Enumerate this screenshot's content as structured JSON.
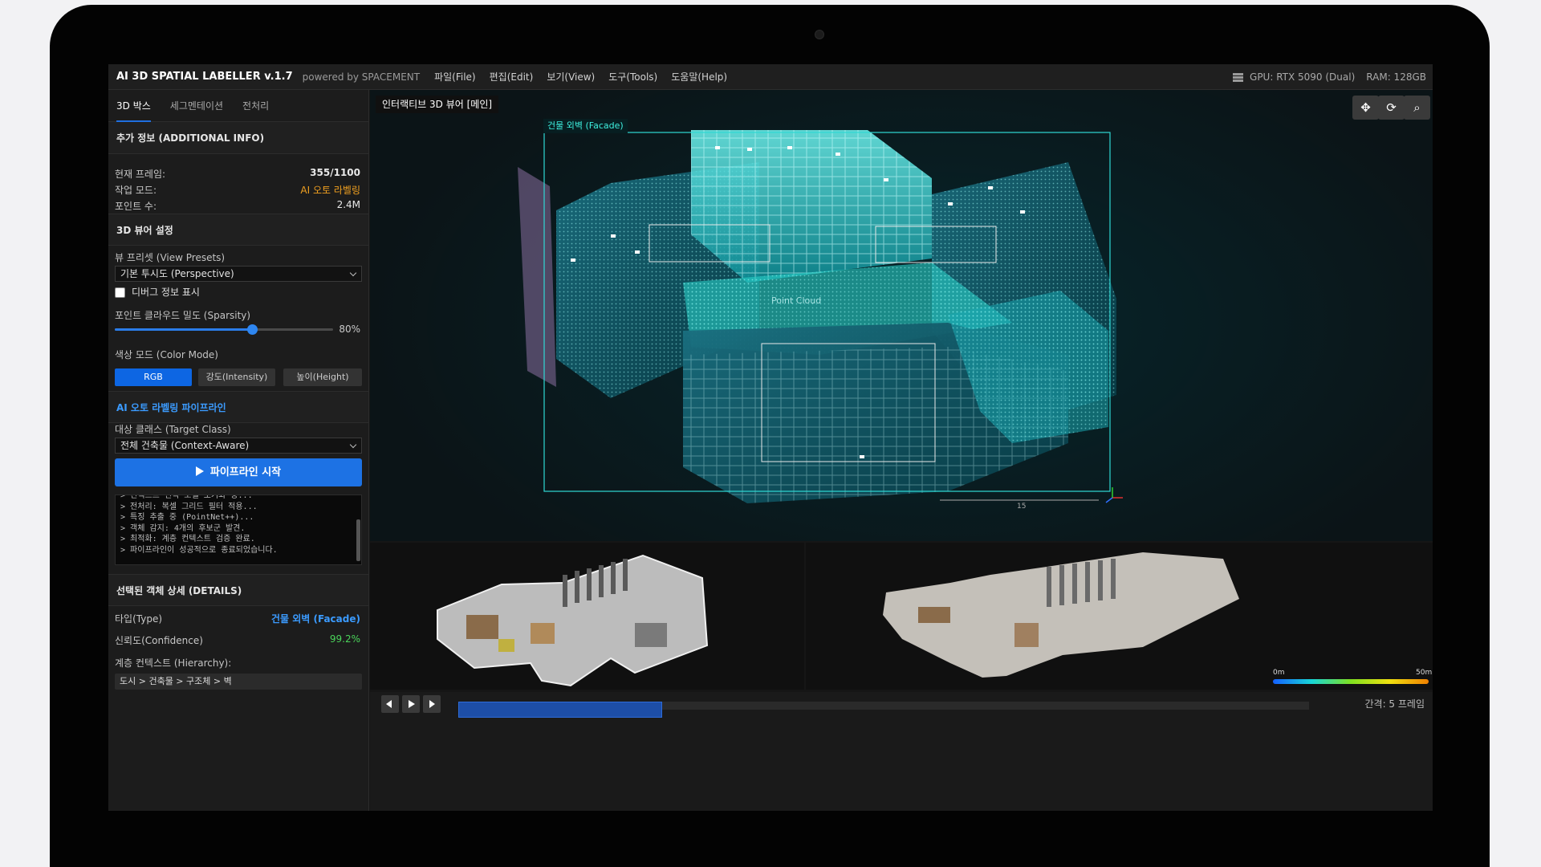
{
  "app": {
    "title": "AI 3D SPATIAL LABELLER v.1.7",
    "powered_by": "powered by SPACEMENT",
    "menu": [
      "파일(File)",
      "편집(Edit)",
      "보기(View)",
      "도구(Tools)",
      "도움말(Help)"
    ],
    "gpu": "GPU: RTX 5090 (Dual)",
    "ram": "RAM: 128GB"
  },
  "left": {
    "tabs": [
      "3D 박스",
      "세그멘테이션",
      "전처리"
    ],
    "additional_info": {
      "header": "추가 정보 (ADDITIONAL INFO)",
      "frame_label": "현재 프레임:",
      "frame_value": "355/1100",
      "mode_label": "작업 모드:",
      "mode_value": "AI 오토 라벨링",
      "points_label": "포인트 수:",
      "points_value": "2.4M"
    },
    "viewer_settings": {
      "header": "3D 뷰어 설정",
      "preset_label": "뷰 프리셋 (View Presets)",
      "preset_value": "기본 투시도 (Perspective)",
      "debug_label": "디버그 정보 표시",
      "density_label": "포인트 클라우드 밀도 (Sparsity)",
      "density_value": "80%",
      "density_fraction": 0.63,
      "color_mode_label": "색상 모드 (Color Mode)",
      "color_modes": [
        "RGB",
        "강도(Intensity)",
        "높이(Height)"
      ]
    },
    "pipeline": {
      "header": "AI 오토 라벨링 파이프라인",
      "target_label": "대상 클래스 (Target Class)",
      "target_value": "전체 건축물 (Context-Aware)",
      "run_label": "파이프라인 시작",
      "log": "> 컨텍스트 인식 모델 초기화 중...\n> 전처리: 복셀 그리드 필터 적용...\n> 특징 추출 중 (PointNet++)...\n> 객체 감지: 4개의 후보군 발견.\n> 최적화: 계층 컨텍스트 검증 완료.\n> 파이프라인이 성공적으로 종료되었습니다."
    },
    "details": {
      "header": "선택된 객체 상세 (DETAILS)",
      "type_label": "타입(Type)",
      "type_value": "건물 외벽 (Facade)",
      "conf_label": "신뢰도(Confidence)",
      "conf_value": "99.2%",
      "hier_label": "계층 컨텍스트 (Hierarchy):",
      "hier_value": "도시 > 건축물 > 구조체 > 벽"
    }
  },
  "viewer": {
    "title": "인터랙티브 3D 뷰어 [메인]",
    "facade_tag": "건물 외벽 (Facade)",
    "cloud_label": "Point Cloud",
    "scale_label": "15",
    "tools": [
      "move-icon",
      "refresh-icon",
      "zoom-icon"
    ]
  },
  "bottom": {
    "legend_min": "0m",
    "legend_max": "50m",
    "interval": "간격: 5 프레임",
    "progress": 0.24
  },
  "colors": {
    "accent": "#1d72e4",
    "cyan": "#3ef0e0",
    "orange": "#f0a020",
    "green": "#4ad45a",
    "blue_text": "#3b9bff"
  }
}
